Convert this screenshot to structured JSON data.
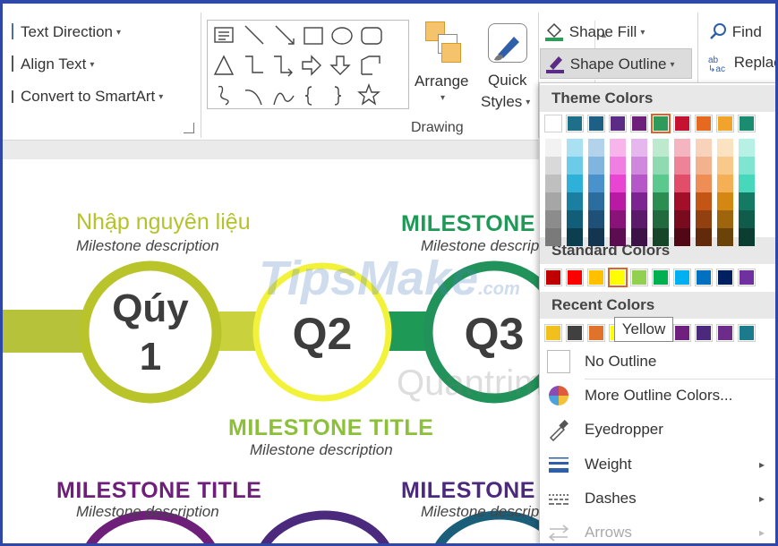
{
  "ribbon": {
    "text_direction": "Text Direction",
    "align_text": "Align Text",
    "convert_smartart": "Convert to SmartArt",
    "arrange": "Arrange",
    "quick_styles_1": "Quick",
    "quick_styles_2": "Styles",
    "shape_fill": "Shape Fill",
    "shape_outline": "Shape Outline",
    "find": "Find",
    "replace": "Replac",
    "drawing_group": "Drawing"
  },
  "dropdown": {
    "theme_colors": "Theme Colors",
    "standard_colors": "Standard Colors",
    "recent_colors": "Recent Colors",
    "theme_top": [
      "#ffffff",
      "#1d6f8a",
      "#1e5f86",
      "#5b2c86",
      "#6d1f7a",
      "#2e9b5a",
      "#c41230",
      "#e56a1f",
      "#f2a32b",
      "#1a8c70"
    ],
    "theme_shades": [
      [
        "#f2f2f2",
        "#d9d9d9",
        "#bfbfbf",
        "#a6a6a6",
        "#8c8c8c",
        "#7a7a7a"
      ],
      [
        "#a9e1f2",
        "#6ccbe8",
        "#2fb0d8",
        "#1a7fa0",
        "#125e78",
        "#0b3f50"
      ],
      [
        "#b3d3ec",
        "#7fb5df",
        "#4a92cc",
        "#2b6d9e",
        "#1f5077",
        "#14354f"
      ],
      [
        "#f7b5ec",
        "#f17ee2",
        "#e846d2",
        "#b81aa3",
        "#8a137a",
        "#5c0d52"
      ],
      [
        "#e5b7ee",
        "#d088df",
        "#b556c9",
        "#7c2590",
        "#5b1b6a",
        "#3d1247"
      ],
      [
        "#bde9ce",
        "#8fdab0",
        "#5bc88e",
        "#2b8d52",
        "#206a3d",
        "#154629"
      ],
      [
        "#f5b5c0",
        "#ee8296",
        "#e24d69",
        "#a30f29",
        "#7a0b1f",
        "#520714"
      ],
      [
        "#f8d2bb",
        "#f3b28d",
        "#ee8e56",
        "#c45515",
        "#934010",
        "#622a0b"
      ],
      [
        "#fbe2c0",
        "#f8c98a",
        "#f5b055",
        "#d48711",
        "#9f650d",
        "#6a4309"
      ],
      [
        "#b7f0e5",
        "#80e5d0",
        "#47d8bb",
        "#157a63",
        "#105c4a",
        "#0b3d31"
      ]
    ],
    "standard": [
      "#c00000",
      "#ff0000",
      "#ffc000",
      "#ffff00",
      "#92d050",
      "#00b050",
      "#00b0f0",
      "#0070c0",
      "#002060",
      "#7030a0"
    ],
    "recent": [
      "#f2c01d",
      "#404040",
      "#e0722b",
      "#ffff00",
      "#4472c4",
      "#7b2a8c",
      "#6f1f7d",
      "#4b2a7d",
      "#6b2c8a",
      "#1b7a8c"
    ],
    "tooltip": "Yellow",
    "no_outline": "No Outline",
    "more_colors": "More Outline Colors...",
    "eyedropper": "Eyedropper",
    "weight": "Weight",
    "dashes": "Dashes",
    "arrows": "Arrows"
  },
  "slide": {
    "m1_title": "Nhập nguyên liệu",
    "m1_desc": "Milestone description",
    "m2_title": "MILESTONE TITLE",
    "m2_desc": "Milestone description",
    "m3_title": "MILESTONE TITLE",
    "m3_desc": "Milestone description",
    "m4_title": "MILESTONE TITLE",
    "m4_desc": "Milestone description",
    "m5_title": "MILESTONE TITLE",
    "m5_desc": "Milestone description",
    "q1a": "Qúy",
    "q1b": "1",
    "q2": "Q2",
    "q3": "Q3",
    "watermark": "TipsMake",
    "watermark_suffix": ".com",
    "watermark2": "Quantrimang"
  }
}
